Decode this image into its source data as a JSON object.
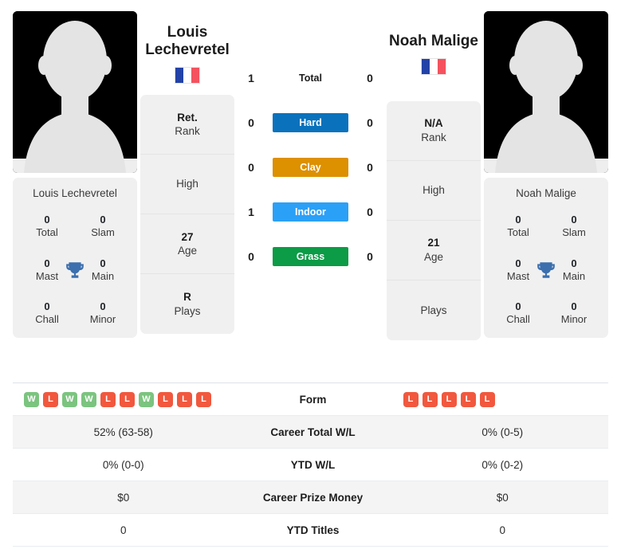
{
  "players": {
    "left": {
      "display_name": "Louis\nLechevretel",
      "card_name": "Louis Lechevretel",
      "flag": {
        "name": "france-flag",
        "colors": [
          "#2242a8",
          "#ffffff",
          "#f4525e"
        ]
      },
      "titles": [
        {
          "num": "0",
          "label": "Total"
        },
        {
          "num": "0",
          "label": "Slam"
        },
        {
          "num": "0",
          "label": "Mast"
        },
        {
          "num": "0",
          "label": "Main"
        },
        {
          "num": "0",
          "label": "Chall"
        },
        {
          "num": "0",
          "label": "Minor"
        }
      ],
      "info": [
        {
          "value": "Ret.",
          "label": "Rank"
        },
        {
          "value": "",
          "label": "High"
        },
        {
          "value": "27",
          "label": "Age"
        },
        {
          "value": "R",
          "label": "Plays"
        }
      ],
      "form": [
        "W",
        "L",
        "W",
        "W",
        "L",
        "L",
        "W",
        "L",
        "L",
        "L"
      ]
    },
    "right": {
      "display_name": "Noah Malige",
      "card_name": "Noah Malige",
      "flag": {
        "name": "france-flag",
        "colors": [
          "#2242a8",
          "#ffffff",
          "#f4525e"
        ]
      },
      "titles": [
        {
          "num": "0",
          "label": "Total"
        },
        {
          "num": "0",
          "label": "Slam"
        },
        {
          "num": "0",
          "label": "Mast"
        },
        {
          "num": "0",
          "label": "Main"
        },
        {
          "num": "0",
          "label": "Chall"
        },
        {
          "num": "0",
          "label": "Minor"
        }
      ],
      "info": [
        {
          "value": "N/A",
          "label": "Rank"
        },
        {
          "value": "",
          "label": "High"
        },
        {
          "value": "21",
          "label": "Age"
        },
        {
          "value": "",
          "label": "Plays"
        }
      ],
      "form": [
        "L",
        "L",
        "L",
        "L",
        "L"
      ]
    }
  },
  "h2h": {
    "rows": [
      {
        "left": "1",
        "label": "Total",
        "right": "0",
        "pill": false,
        "color": ""
      },
      {
        "left": "0",
        "label": "Hard",
        "right": "0",
        "pill": true,
        "color": "#0a72bd"
      },
      {
        "left": "0",
        "label": "Clay",
        "right": "0",
        "pill": true,
        "color": "#dd9000"
      },
      {
        "left": "1",
        "label": "Indoor",
        "right": "0",
        "pill": true,
        "color": "#2ba0f7"
      },
      {
        "left": "0",
        "label": "Grass",
        "right": "0",
        "pill": true,
        "color": "#0c9b46"
      }
    ]
  },
  "stats_table": {
    "rows": [
      {
        "label": "Form",
        "left": "",
        "right": "",
        "type": "form"
      },
      {
        "label": "Career Total W/L",
        "left": "52% (63-58)",
        "right": "0% (0-5)",
        "type": "text"
      },
      {
        "label": "YTD W/L",
        "left": "0% (0-0)",
        "right": "0% (0-2)",
        "type": "text"
      },
      {
        "label": "Career Prize Money",
        "left": "$0",
        "right": "$0",
        "type": "text"
      },
      {
        "label": "YTD Titles",
        "left": "0",
        "right": "0",
        "type": "text"
      }
    ]
  }
}
